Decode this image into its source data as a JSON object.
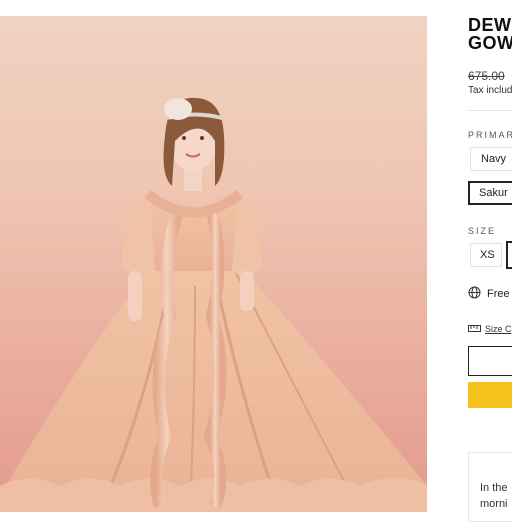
{
  "product": {
    "title_line1": "DEW",
    "title_line2": "GOW",
    "price": "675.00",
    "tax_note": "Tax includ"
  },
  "color": {
    "label": "PRIMAR",
    "options": [
      "Navy",
      "Sakur"
    ],
    "selected": "Sakur"
  },
  "size": {
    "label": "SIZE",
    "options": [
      "XS",
      ""
    ],
    "selected": ""
  },
  "shipping": {
    "text": "Free",
    "icon": "globe-icon"
  },
  "size_chart": {
    "text": "Size C",
    "icon": "ruler-icon"
  },
  "buttons": {
    "add_to_cart": "",
    "buy_now": "",
    "accent": "#f6c21d"
  },
  "description": {
    "line1": "In the",
    "line2": "morni"
  }
}
